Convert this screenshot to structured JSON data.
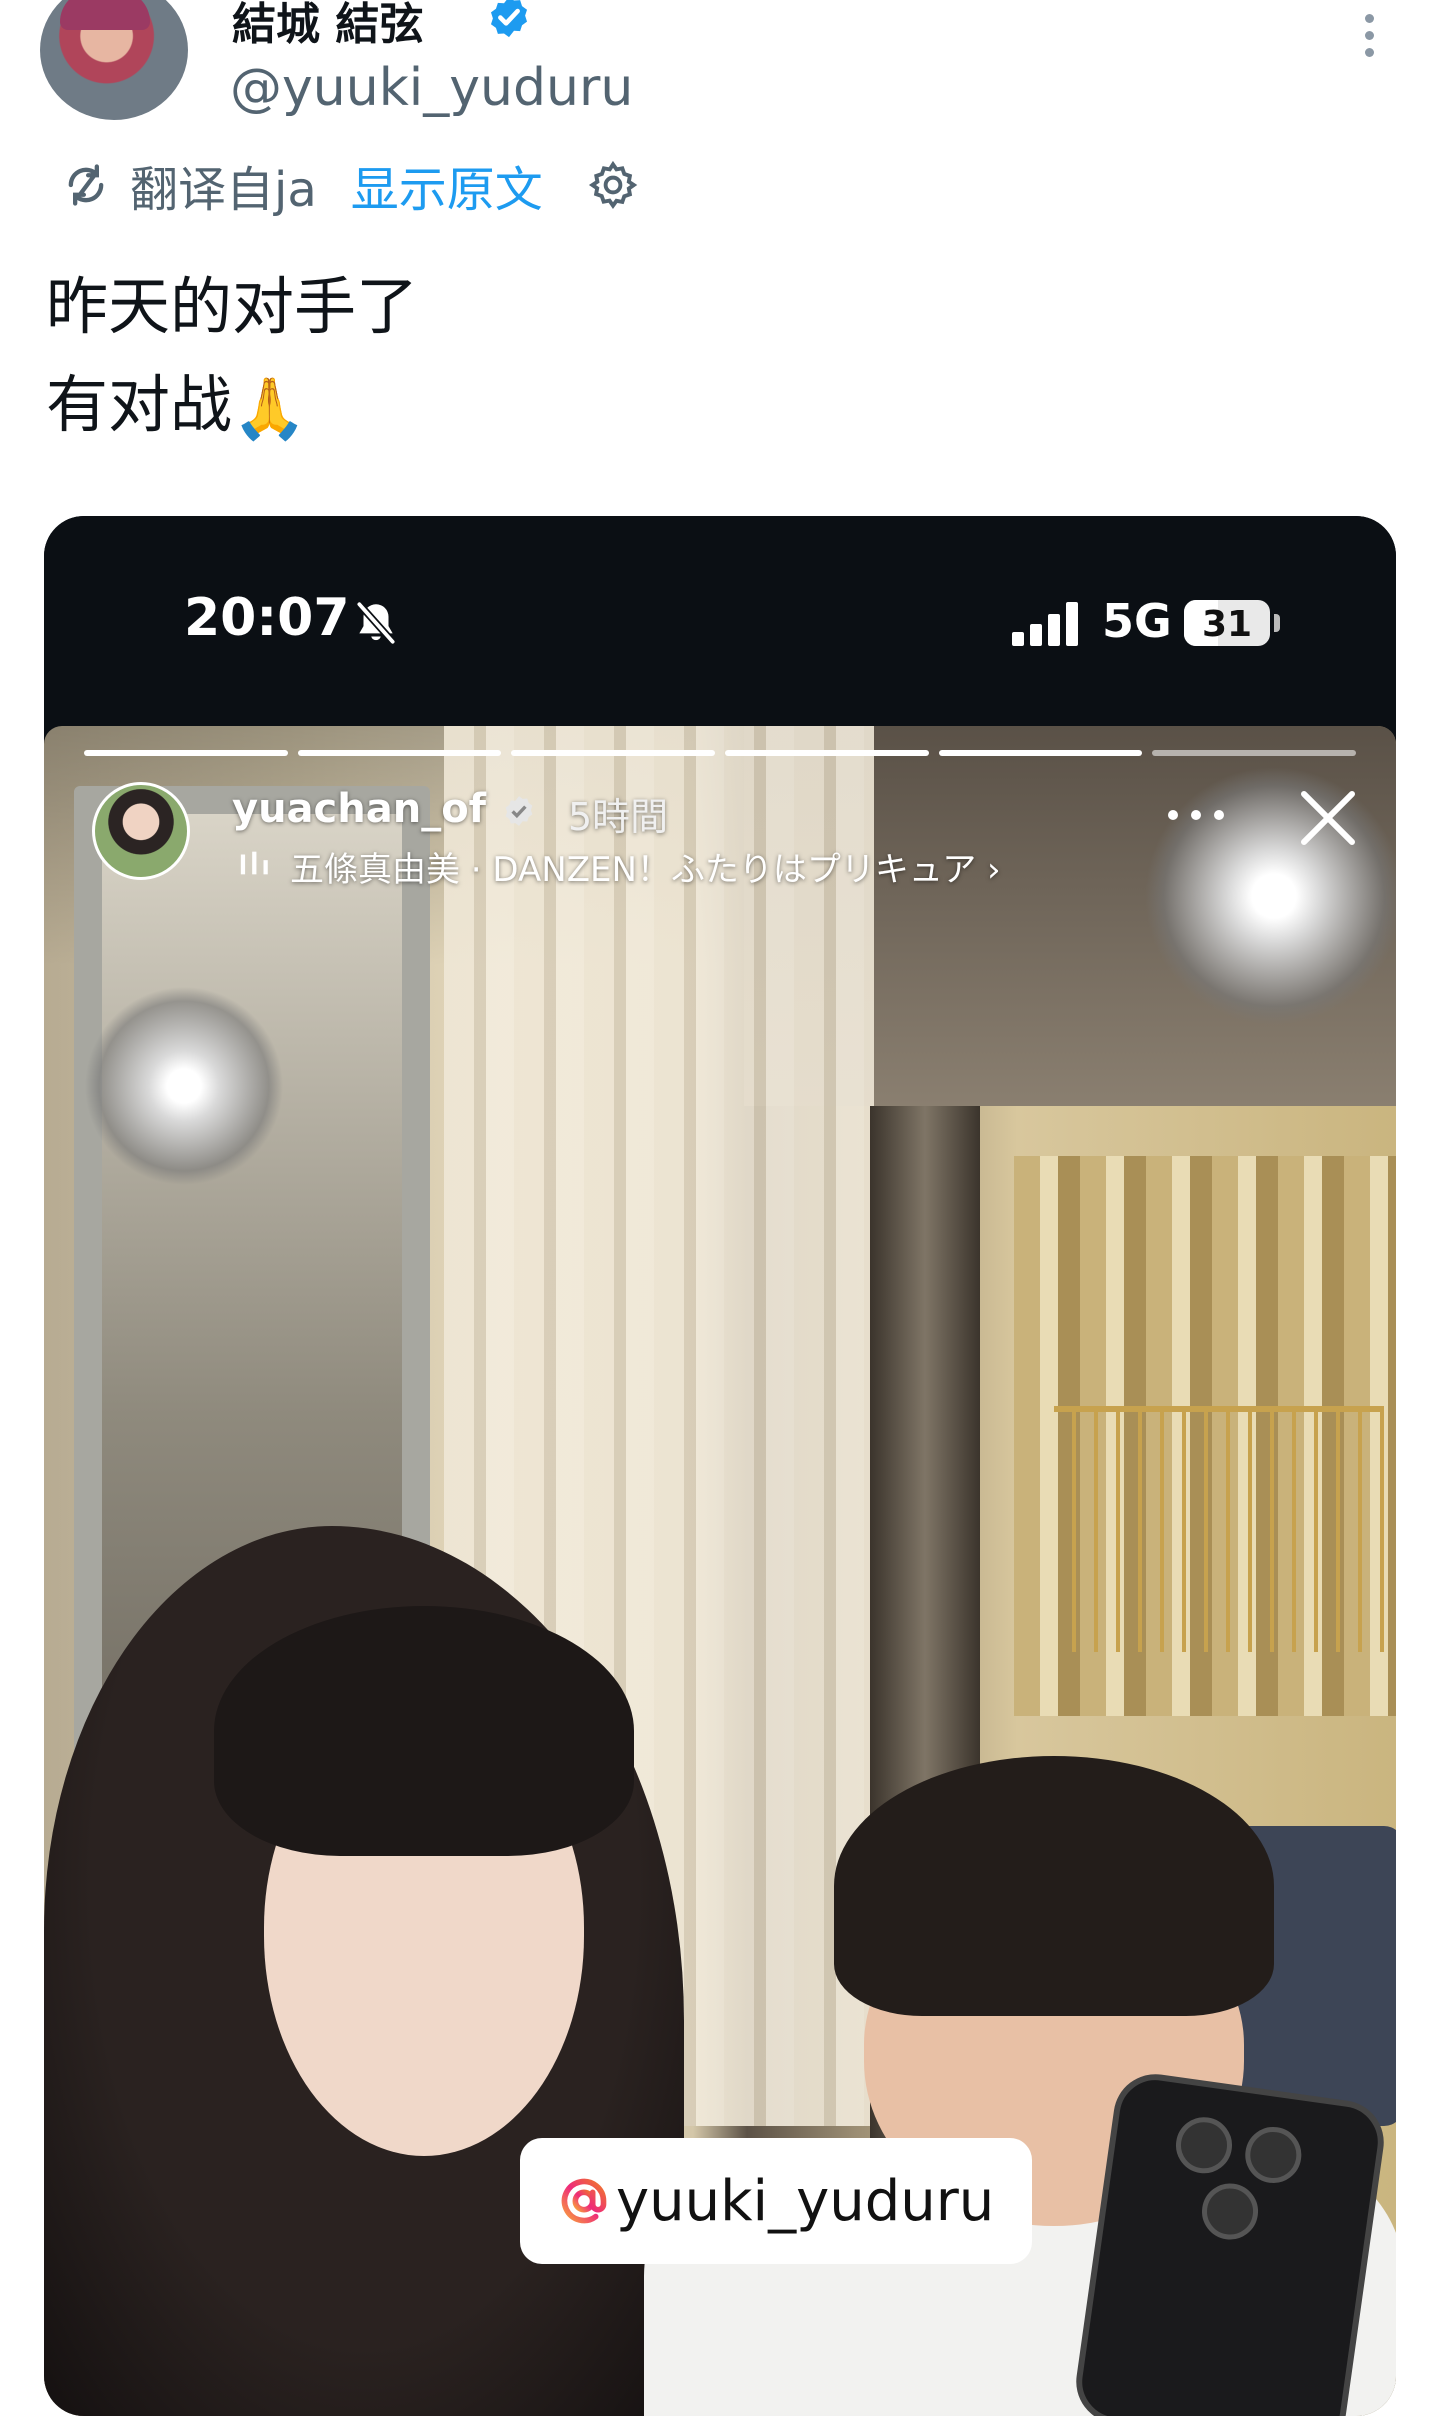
{
  "tweet": {
    "display_name": "結城 結弦",
    "handle": "@yuuki_yuduru",
    "translation": {
      "label": "翻译自ja",
      "show_original": "显示原文"
    },
    "text_lines": [
      "昨天的对手了",
      "有对战"
    ],
    "emoji": "🙏"
  },
  "phone_status": {
    "time": "20:07",
    "network": "5G",
    "battery": "31"
  },
  "story": {
    "username": "yuachan_of",
    "time_ago": "5時間",
    "music": "五條真由美 · DANZEN！ふたりはプリキュア ›",
    "mention": "yuuki_yuduru"
  },
  "colors": {
    "link": "#1d9bf0",
    "secondary_text": "#536471",
    "verified": "#1d9bf0"
  }
}
